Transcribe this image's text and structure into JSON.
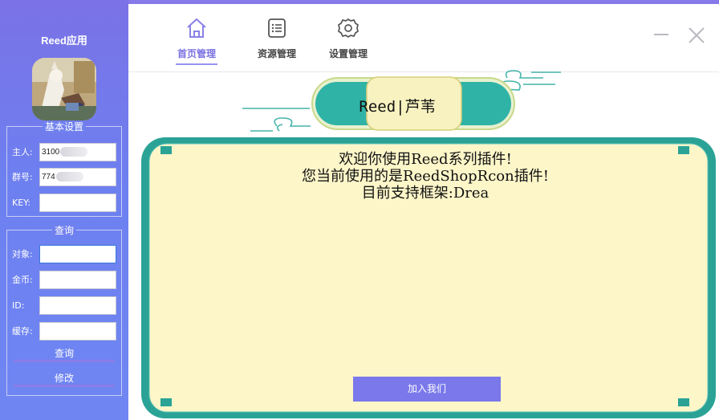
{
  "app": {
    "title": "Reed应用"
  },
  "settings": {
    "legend": "基本设置",
    "owner_label": "主人:",
    "owner_value": "3100",
    "group_label": "群号:",
    "group_value": "774",
    "key_label": "KEY:",
    "key_value": ""
  },
  "query": {
    "legend": "查询",
    "target_label": "对象:",
    "coins_label": "金币:",
    "id_label": "ID:",
    "cache_label": "缓存:",
    "query_button": "查询",
    "modify_button": "修改"
  },
  "tabs": [
    {
      "label": "首页管理",
      "icon": "home-icon",
      "active": true
    },
    {
      "label": "资源管理",
      "icon": "list-icon",
      "active": false
    },
    {
      "label": "设置管理",
      "icon": "gear-icon",
      "active": false
    }
  ],
  "content": {
    "banner": "Reed|芦苇",
    "line1": "欢迎你使用Reed系列插件!",
    "line2": "您当前使用的是ReedShopRcon插件!",
    "line3": "目前支持框架:Drea",
    "join_button": "加入我们"
  },
  "colors": {
    "sidebar": "#7080ee",
    "accent": "#7b72e0",
    "board_border": "#2aa396",
    "board_fill": "#fdf6c9",
    "button": "#7a78ea"
  }
}
